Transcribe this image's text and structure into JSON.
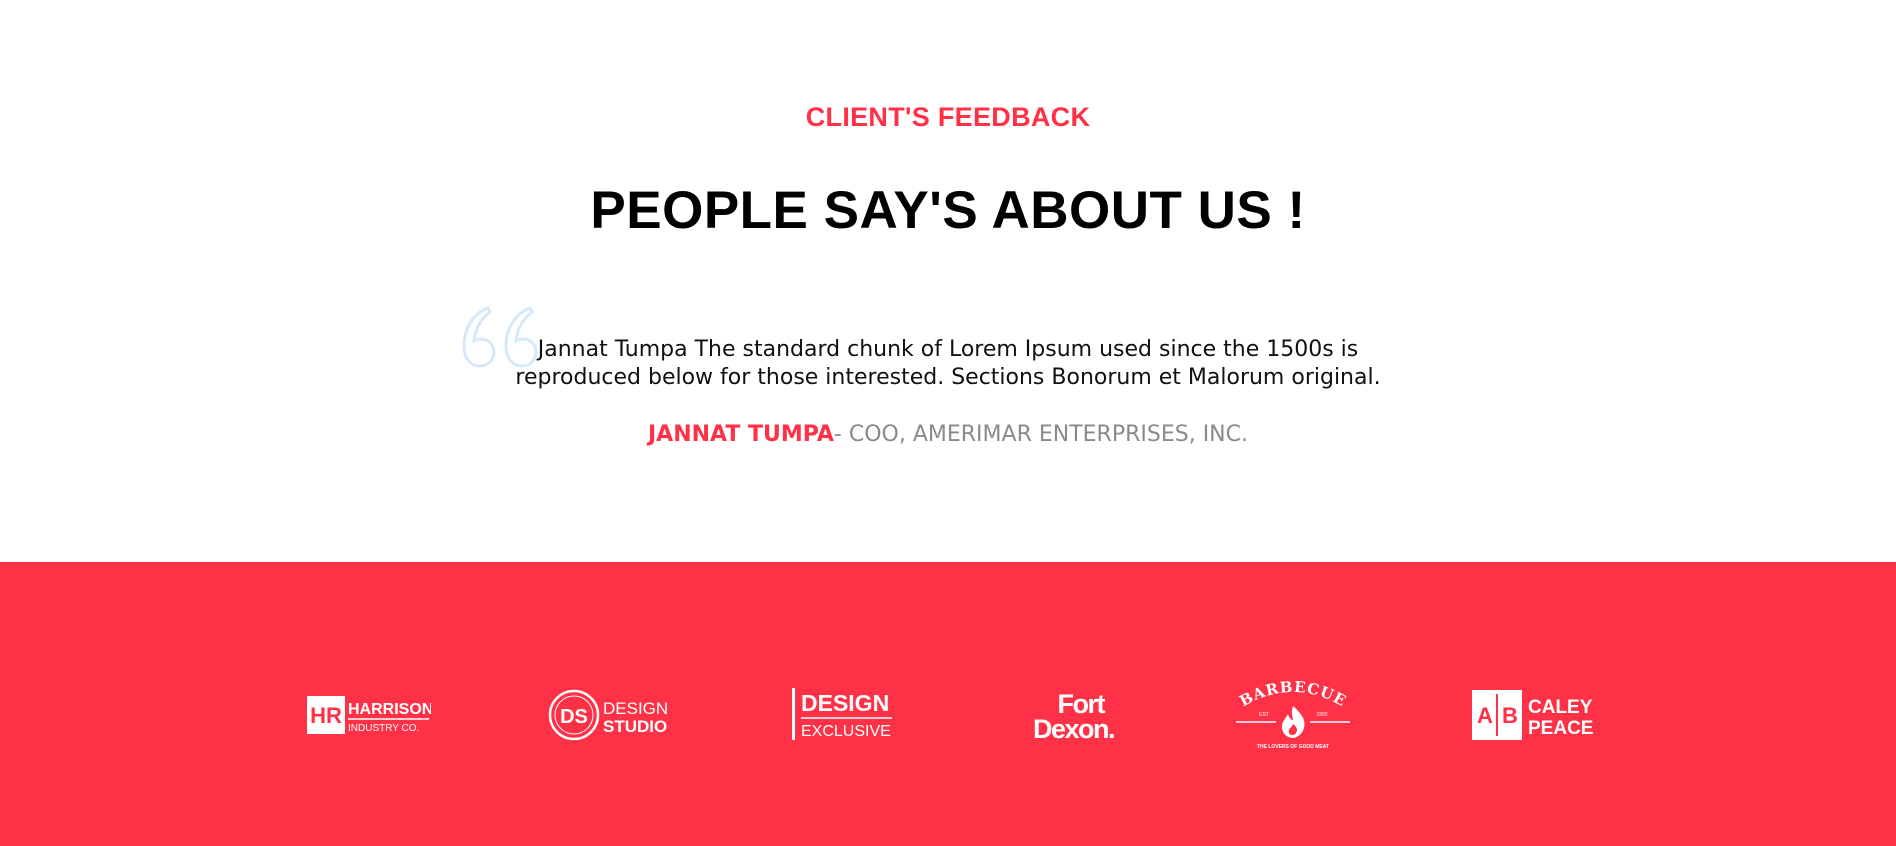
{
  "testimonials": {
    "eyebrow": "CLIENT'S FEEDBACK",
    "heading": "PEOPLE SAY'S ABOUT US !",
    "quote": "Jannat Tumpa The standard chunk of Lorem Ipsum used since the 1500s is reproduced below for those interested. Sections Bonorum et Malorum original.",
    "author_name": "JANNAT TUMPA",
    "author_role": "- COO, AMERIMAR ENTERPRISES, INC.",
    "quote_icon": "quote-mark-icon"
  },
  "brands": {
    "harrison": {
      "mark": "HR",
      "name": "HARRISON",
      "sub": "INDUSTRY CO."
    },
    "design_studio": {
      "mark": "DS",
      "line1": "DESIGN",
      "line2": "STUDIO"
    },
    "design_exclusive": {
      "line1": "DESIGN",
      "line2": "EXCLUSIVE"
    },
    "fort_dexon": {
      "line1": "Fort",
      "line2": "Dexon."
    },
    "barbecue": {
      "name": "BARBECUE",
      "est": "EST",
      "year": "1992",
      "tagline": "THE LOVERS OF GOOD MEAT",
      "icon": "flame-icon"
    },
    "caley_peace": {
      "mark_left": "A",
      "mark_right": "B",
      "line1": "CALEY",
      "line2": "PEACE"
    }
  },
  "colors": {
    "accent": "#ff3146",
    "quote_icon": "#d6e9fb",
    "role_text": "#8a8a8a"
  }
}
